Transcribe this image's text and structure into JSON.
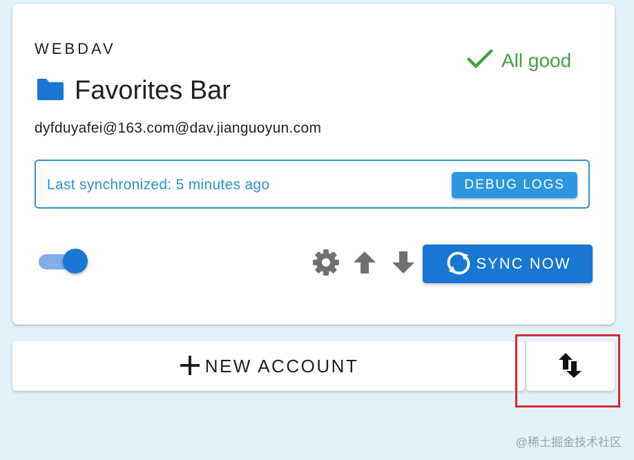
{
  "account": {
    "type": "WEBDAV",
    "status": "All good",
    "folder_title": "Favorites Bar",
    "account_id": "dyfduyafei@163.com@dav.jianguoyun.com",
    "last_synced": "Last synchronized: 5 minutes ago",
    "debug_label": "DEBUG LOGS",
    "sync_label": "SYNC NOW",
    "enabled": true
  },
  "footer": {
    "new_account_label": "NEW ACCOUNT",
    "watermark": "@稀土掘金技术社区"
  },
  "icons": {
    "status": "check-icon",
    "folder": "folder-icon",
    "settings": "gear-icon",
    "upload": "arrow-up-icon",
    "download": "arrow-down-icon",
    "sync": "sync-icon",
    "add": "plus-icon",
    "sort": "swap-vertical-icon"
  },
  "colors": {
    "primary": "#1976d2",
    "accent": "#2d96df",
    "success": "#43a047",
    "background": "#e3f1fb",
    "highlight": "#d9262e"
  }
}
